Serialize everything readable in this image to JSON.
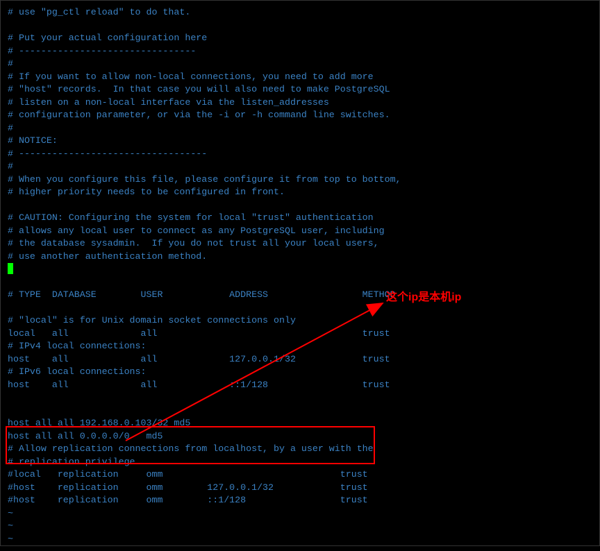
{
  "annotation": {
    "label": "这个ip是本机ip"
  },
  "lines": {
    "l0": "# use \"pg_ctl reload\" to do that.",
    "l1": "",
    "l2": "# Put your actual configuration here",
    "l3": "# --------------------------------",
    "l4": "#",
    "l5": "# If you want to allow non-local connections, you need to add more",
    "l6": "# \"host\" records.  In that case you will also need to make PostgreSQL",
    "l7": "# listen on a non-local interface via the listen_addresses",
    "l8": "# configuration parameter, or via the -i or -h command line switches.",
    "l9": "#",
    "l10": "# NOTICE:",
    "l11": "# ----------------------------------",
    "l12": "#",
    "l13": "# When you configure this file, please configure it from top to bottom,",
    "l14": "# higher priority needs to be configured in front.",
    "l15": "",
    "l16": "# CAUTION: Configuring the system for local \"trust\" authentication",
    "l17": "# allows any local user to connect as any PostgreSQL user, including",
    "l18": "# the database sysadmin.  If you do not trust all your local users,",
    "l19": "# use another authentication method.",
    "l20": "",
    "l21": "",
    "l22": "# TYPE  DATABASE        USER            ADDRESS                 METHOD",
    "l23": "",
    "l24": "# \"local\" is for Unix domain socket connections only",
    "l25": "local   all             all                                     trust",
    "l26": "# IPv4 local connections:",
    "l27": "host    all             all             127.0.0.1/32            trust",
    "l28": "# IPv6 local connections:",
    "l29": "host    all             all             ::1/128                 trust",
    "l30": "",
    "l31": "",
    "l32": "host all all 192.168.0.103/32 md5",
    "l33": "host all all 0.0.0.0/0   md5",
    "l34": "# Allow replication connections from localhost, by a user with the",
    "l35": "# replication privilege.",
    "l36": "#local   replication     omm                                trust",
    "l37": "#host    replication     omm        127.0.0.1/32            trust",
    "l38": "#host    replication     omm        ::1/128                 trust",
    "t1": "~",
    "t2": "~",
    "t3": "~"
  }
}
